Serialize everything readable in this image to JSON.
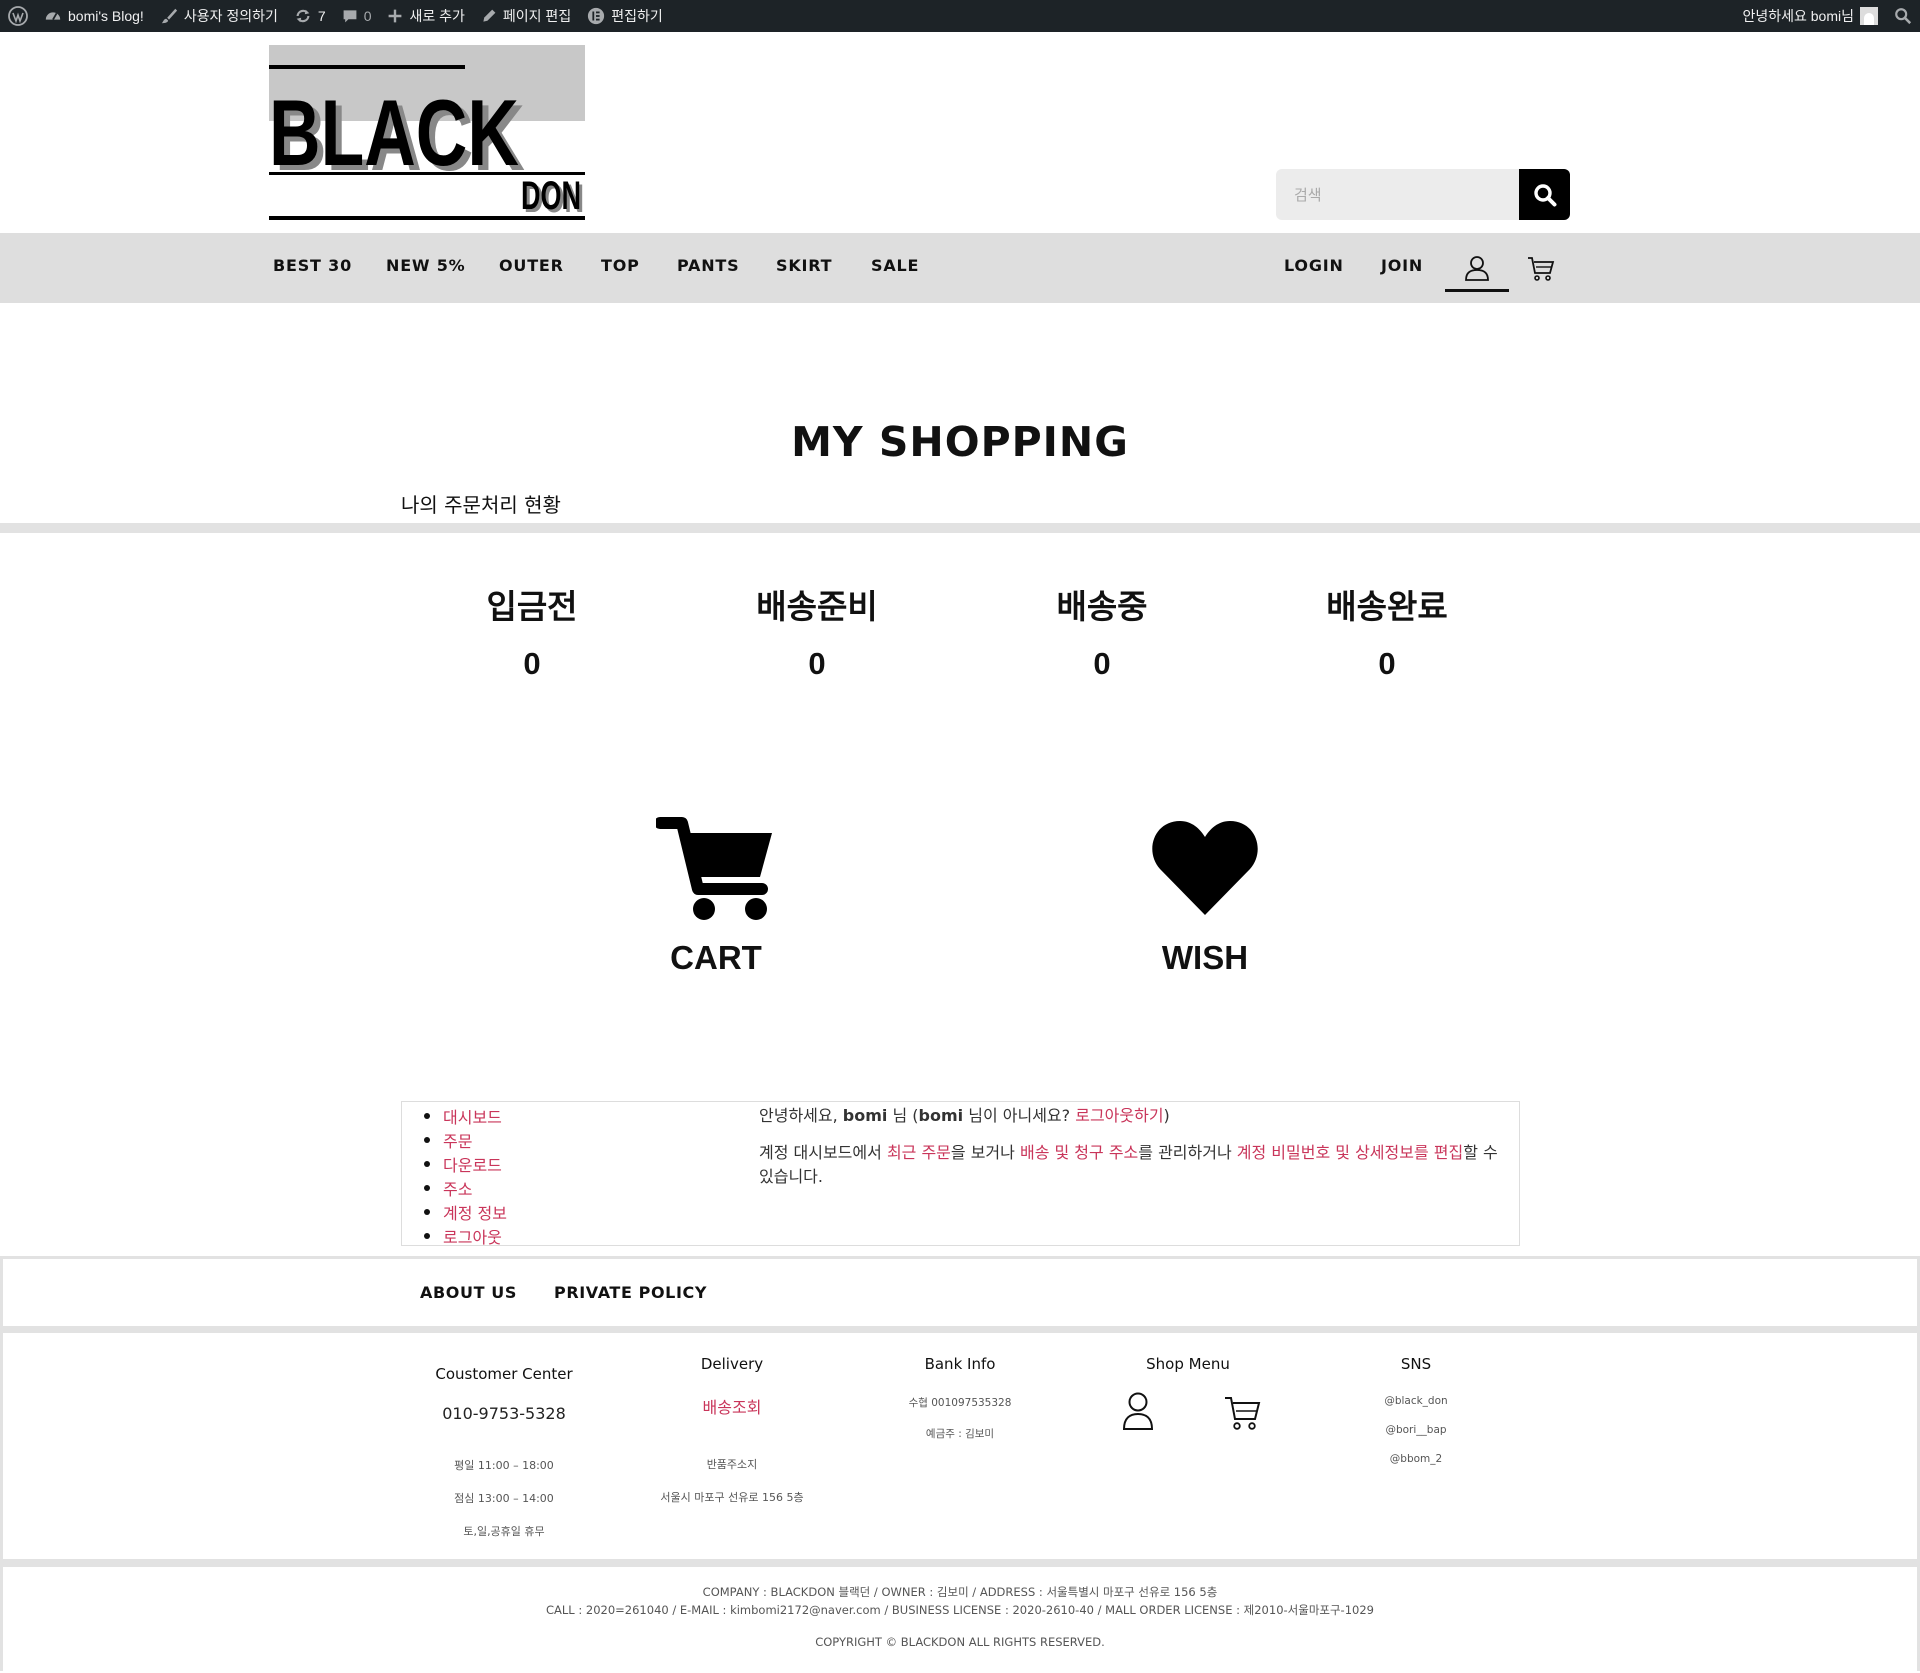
{
  "admin_bar": {
    "site_name": "bomi's Blog!",
    "customize": "사용자 정의하기",
    "updates_count": "7",
    "comments_count": "0",
    "new": "새로 추가",
    "edit_page": "페이지 편집",
    "elementor_edit": "편집하기",
    "greeting": "안녕하세요 bomi님"
  },
  "logo": {
    "line1": "BLACK",
    "line2": "DON"
  },
  "search": {
    "placeholder": "검색"
  },
  "nav": {
    "items": [
      "BEST 30",
      "NEW 5%",
      "OUTER",
      "TOP",
      "PANTS",
      "SKIRT",
      "SALE"
    ],
    "login": "LOGIN",
    "join": "JOIN"
  },
  "my_shopping": {
    "title": "MY SHOPPING",
    "order_status_title": "나의 주문처리 현황",
    "statuses": [
      {
        "label": "입금전",
        "count": "0"
      },
      {
        "label": "배송준비",
        "count": "0"
      },
      {
        "label": "배송중",
        "count": "0"
      },
      {
        "label": "배송완료",
        "count": "0"
      }
    ],
    "cart_label": "CART",
    "wish_label": "WISH"
  },
  "account": {
    "nav": [
      "대시보드",
      "주문",
      "다운로드",
      "주소",
      "계정 정보",
      "로그아웃"
    ],
    "hello_prefix": "안녕하세요, ",
    "username": "bomi",
    "hello_mid1": " 님 (",
    "hello_mid2": " 님이 아니세요? ",
    "logout_link": "로그아웃하기",
    "hello_end": ")",
    "dash_prefix": "계정 대시보드에서 ",
    "recent_orders_link": "최근 주문",
    "dash_mid1": "을 보거나 ",
    "addresses_link": "배송 및 청구 주소",
    "dash_mid2": "를 관리하거나 ",
    "edit_account_link": "계정 비밀번호 및 상세정보를 편집",
    "dash_end": "할 수 있습니다."
  },
  "footer": {
    "links": [
      "ABOUT US",
      "PRIVATE POLICY"
    ],
    "customer_center": {
      "title": "Coustomer Center",
      "phone": "010-9753-5328",
      "hours": [
        "평일 11:00 – 18:00",
        "점심 13:00 – 14:00",
        "토,일,공휴일 휴무"
      ]
    },
    "delivery": {
      "title": "Delivery",
      "track_link": "배송조회",
      "return_label": "반품주소지",
      "return_address": "서울시 마포구 선유로 156 5층"
    },
    "bank": {
      "title": "Bank Info",
      "account": "수협  001097535328",
      "holder": "예금주 : 김보미"
    },
    "shop_menu": {
      "title": "Shop Menu"
    },
    "sns": {
      "title": "SNS",
      "handles": [
        "@black_don",
        "@bori__bap",
        "@bbom_2"
      ]
    },
    "company_line1": "COMPANY : BLACKDON 블랙던 / OWNER : 김보미 / ADDRESS :  서울특별시 마포구 선유로 156 5층",
    "company_line2": "CALL : 2020=261040 / E-MAIL : kimbomi2172@naver.com / BUSINESS LICENSE : 2020-2610-40 / MALL ORDER LICENSE : 제2010-서울마포구-1029",
    "copyright": "COPYRIGHT © BLACKDON ALL RIGHTS RESERVED."
  },
  "colors": {
    "link": "#c9355a",
    "admin_bar_bg": "#1d2327",
    "nav_bg": "#dedede",
    "logo_box": "#c8c8c8"
  }
}
